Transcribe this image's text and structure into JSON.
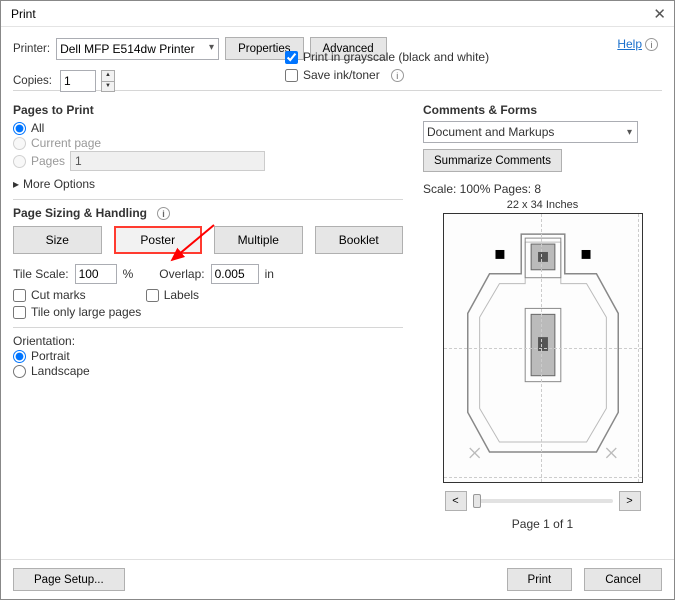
{
  "window": {
    "title": "Print"
  },
  "top": {
    "printer_label": "Printer:",
    "printer_value": "Dell MFP E514dw Printer",
    "properties": "Properties",
    "advanced": "Advanced",
    "help": "Help",
    "copies_label": "Copies:",
    "copies_value": "1",
    "grayscale_checked": true,
    "grayscale_label": "Print in grayscale (black and white)",
    "saveink_checked": false,
    "saveink_label": "Save ink/toner"
  },
  "pages": {
    "title": "Pages to Print",
    "all_label": "All",
    "current_label": "Current page",
    "pages_label": "Pages",
    "pages_value": "1",
    "selected": "all",
    "more_options": "More Options"
  },
  "sizing": {
    "title": "Page Sizing & Handling",
    "size": "Size",
    "poster": "Poster",
    "multiple": "Multiple",
    "booklet": "Booklet",
    "tile_scale_label": "Tile Scale:",
    "tile_scale_value": "100",
    "tile_scale_unit": "%",
    "overlap_label": "Overlap:",
    "overlap_value": "0.005",
    "overlap_unit": "in",
    "cut_marks": "Cut marks",
    "labels": "Labels",
    "tile_large": "Tile only large pages"
  },
  "orientation": {
    "title": "Orientation:",
    "portrait": "Portrait",
    "landscape": "Landscape",
    "selected": "portrait"
  },
  "comments": {
    "title": "Comments & Forms",
    "combo": "Document and Markups",
    "summarize": "Summarize Comments"
  },
  "preview": {
    "scale_pages": "Scale: 100% Pages: 8",
    "dims": "22 x 34 Inches",
    "page_of": "Page 1 of 1"
  },
  "bottom": {
    "page_setup": "Page Setup...",
    "print": "Print",
    "cancel": "Cancel"
  }
}
